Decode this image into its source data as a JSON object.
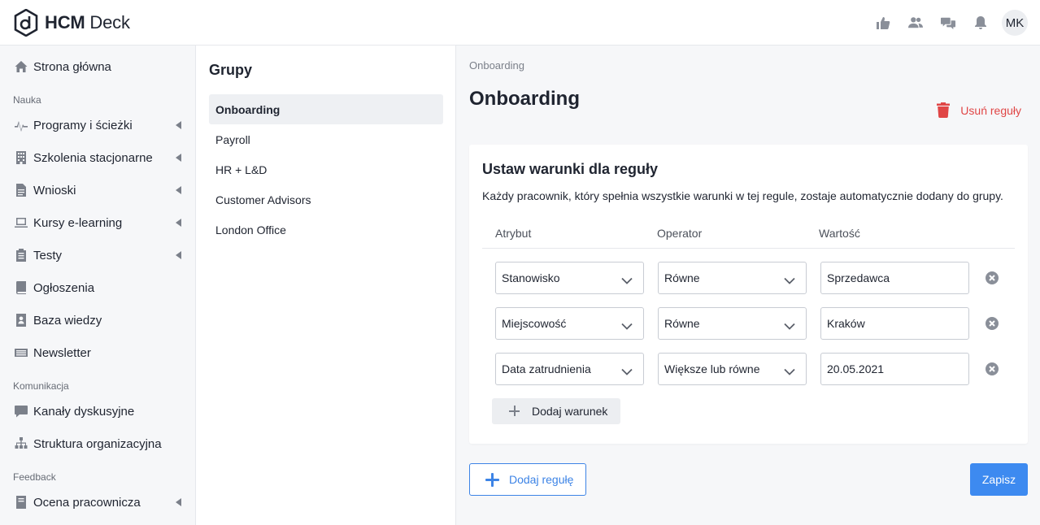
{
  "app": {
    "logo_bold": "HCM",
    "logo_light": " Deck"
  },
  "topbar": {
    "icons": [
      "thumbs-up-icon",
      "users-icon",
      "chat-icon",
      "bell-icon"
    ],
    "avatar_initials": "MK"
  },
  "sidebar": {
    "items": [
      {
        "label": "Strona główna",
        "icon": "home-icon"
      },
      {
        "section": "Nauka"
      },
      {
        "label": "Programy i ścieżki",
        "icon": "pulse-icon",
        "has_submenu": true
      },
      {
        "label": "Szkolenia stacjonarne",
        "icon": "building-icon",
        "has_submenu": true
      },
      {
        "label": "Wnioski",
        "icon": "document-icon",
        "has_submenu": true
      },
      {
        "label": "Kursy e-learning",
        "icon": "laptop-icon",
        "has_submenu": true
      },
      {
        "label": "Testy",
        "icon": "clipboard-icon",
        "has_submenu": true
      },
      {
        "label": "Ogłoszenia",
        "icon": "book-icon"
      },
      {
        "label": "Baza wiedzy",
        "icon": "address-book-icon"
      },
      {
        "label": "Newsletter",
        "icon": "newspaper-icon"
      },
      {
        "section": "Komunikacja"
      },
      {
        "label": "Kanały dyskusyjne",
        "icon": "comment-icon"
      },
      {
        "label": "Struktura organizacyjna",
        "icon": "sitemap-icon"
      },
      {
        "section": "Feedback"
      },
      {
        "label": "Ocena pracownicza",
        "icon": "badge-icon",
        "has_submenu": true
      }
    ]
  },
  "groups": {
    "title": "Grupy",
    "items": [
      "Onboarding",
      "Payroll",
      "HR + L&D",
      "Customer Advisors",
      "London Office"
    ],
    "active": "Onboarding"
  },
  "main": {
    "breadcrumb": "Onboarding",
    "title": "Onboarding",
    "delete_rules": "Usuń reguły",
    "card": {
      "title": "Ustaw warunki dla reguły",
      "description": "Każdy pracownik, który spełnia wszystkie warunki w tej regule, zostaje automatycznie dodany do grupy.",
      "columns": {
        "attribute": "Atrybut",
        "operator": "Operator",
        "value": "Wartość"
      },
      "conditions": [
        {
          "attribute": "Stanowisko",
          "operator": "Równe",
          "value": "Sprzedawca"
        },
        {
          "attribute": "Miejscowość",
          "operator": "Równe",
          "value": "Kraków"
        },
        {
          "attribute": "Data zatrudnienia",
          "operator": "Większe lub równe",
          "value": "20.05.2021"
        }
      ],
      "add_condition": "Dodaj warunek"
    },
    "add_rule": "Dodaj regułę",
    "save": "Zapisz"
  },
  "colors": {
    "accent": "#3d8af0",
    "danger": "#e04646"
  }
}
